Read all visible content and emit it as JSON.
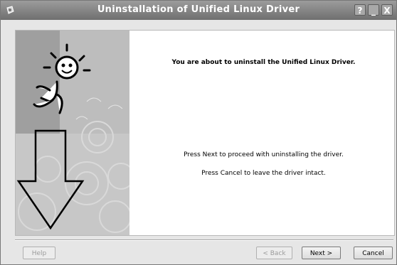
{
  "window": {
    "title": "Uninstallation of Unified Linux Driver",
    "controls": {
      "help": "?",
      "minimize": "_",
      "close": "X"
    }
  },
  "content": {
    "heading": "You are about to uninstall the Unified Linux Driver.",
    "line1": "Press Next to proceed with uninstalling the driver.",
    "line2": "Press Cancel to leave the driver intact."
  },
  "buttons": {
    "help": "Help",
    "back": "< Back",
    "next": "Next >",
    "cancel": "Cancel"
  },
  "colors": {
    "titlebar": "#828282",
    "art": "#bcbcbc"
  },
  "icons": {
    "app": "gear-icon",
    "art": "figure-with-down-arrow-illustration"
  }
}
